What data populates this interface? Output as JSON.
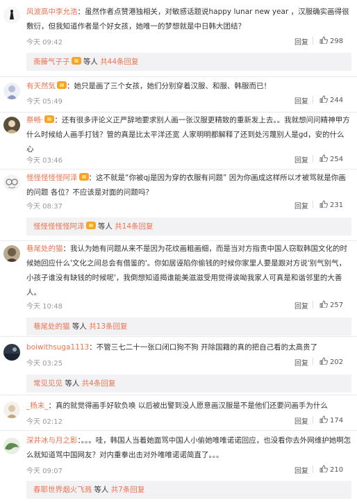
{
  "reply_label": "回复",
  "comments": [
    {
      "user": "风波高中李允浩",
      "text": "：虽然作者点赞港独相关，对敏感话题说happy lunar new year ，汉服确实画得很敷衍，但我知道作者是个好女孩，她唯一的梦想就是中日韩大团结？",
      "time": "今天 09:42",
      "likes": "298",
      "replies_user": "斋藤气子子",
      "replies_mid": " 等人 ",
      "replies_count": "共44条回复"
    },
    {
      "user": "有天然気",
      "text": "：她只是画了三个女孩，她们分别穿着汉服、和服、韩服而已！",
      "time": "今天 05:49",
      "likes": "244"
    },
    {
      "user": "祭畅·",
      "text": "：还有很多评论义正严辞地要求别人画一张汉服更精致的重新发上去。。我就想问问精神甲方什么时候给人画手打钱？管的真是比太平洋还宽 人家明明都解释了还到处污蔑别人是gd，安的什么心",
      "time": "今天 03:46",
      "likes": "254"
    },
    {
      "user": "怪怪怪怪怪阿泽",
      "text": "：这不就是“你被qj是因为穿的衣服有问题” 因为你画成这样所以才被骂就是你画的问题 各位？不应该是对面的问题吗？",
      "time": "今天 08:37",
      "likes": "231",
      "replies_user": "怪怪怪怪怪阿泽",
      "replies_mid": " 等人 ",
      "replies_count": "共14条回复"
    },
    {
      "user": "巷尾处的猫",
      "text": "：我认为她有问题从来不是因为花纹画粗画细，而是当对方指责中国人窃取韩国文化的时候她回应什么'文化之间总会有借鉴的'。你如居诬陷你偷钱的时候你家里人要是跟对方说'别气别气，小孩子谁没有缺钱的时候呢'，我倒想知道揭谁能美滋滋受用觉得诶呦我家人可真是和谐邻里的大善人。",
      "time": "今天 10:48",
      "likes": "257",
      "replies_user": "巷尾处的猫",
      "replies_mid": " 等人 ",
      "replies_count": "共13条回复"
    },
    {
      "user": "boiwithsuga1113",
      "text": "：不管三七二十一张口闭口狗不狗 开除国籍的真的把自己看的太高贵了",
      "time": "今天 03:25",
      "likes": "202",
      "replies_user": "常见见见",
      "replies_mid": " 等人 ",
      "replies_count": "共4条回复"
    },
    {
      "user": "_杨未_",
      "text": "：真的就觉得画手好软负唤 以后被出警到没人愿意画汉服是不是他们还要问画手为什么",
      "time": "今天 02:12",
      "likes": "174"
    },
    {
      "user": "深井冰与月之影",
      "text": "：。。。哇，韩国人当着她面骂中国人小偷她唯唯诺诺回应，也没看你去外网维护她啊怎么就知道骂中国网友？对内重拳出击对外唯唯诺诺简直了。。。",
      "time": "今天 09:07",
      "likes": "210",
      "replies_user": "春耶世界烟火飞溅",
      "replies_mid": " 等人 ",
      "replies_count": "共7条回复"
    }
  ]
}
